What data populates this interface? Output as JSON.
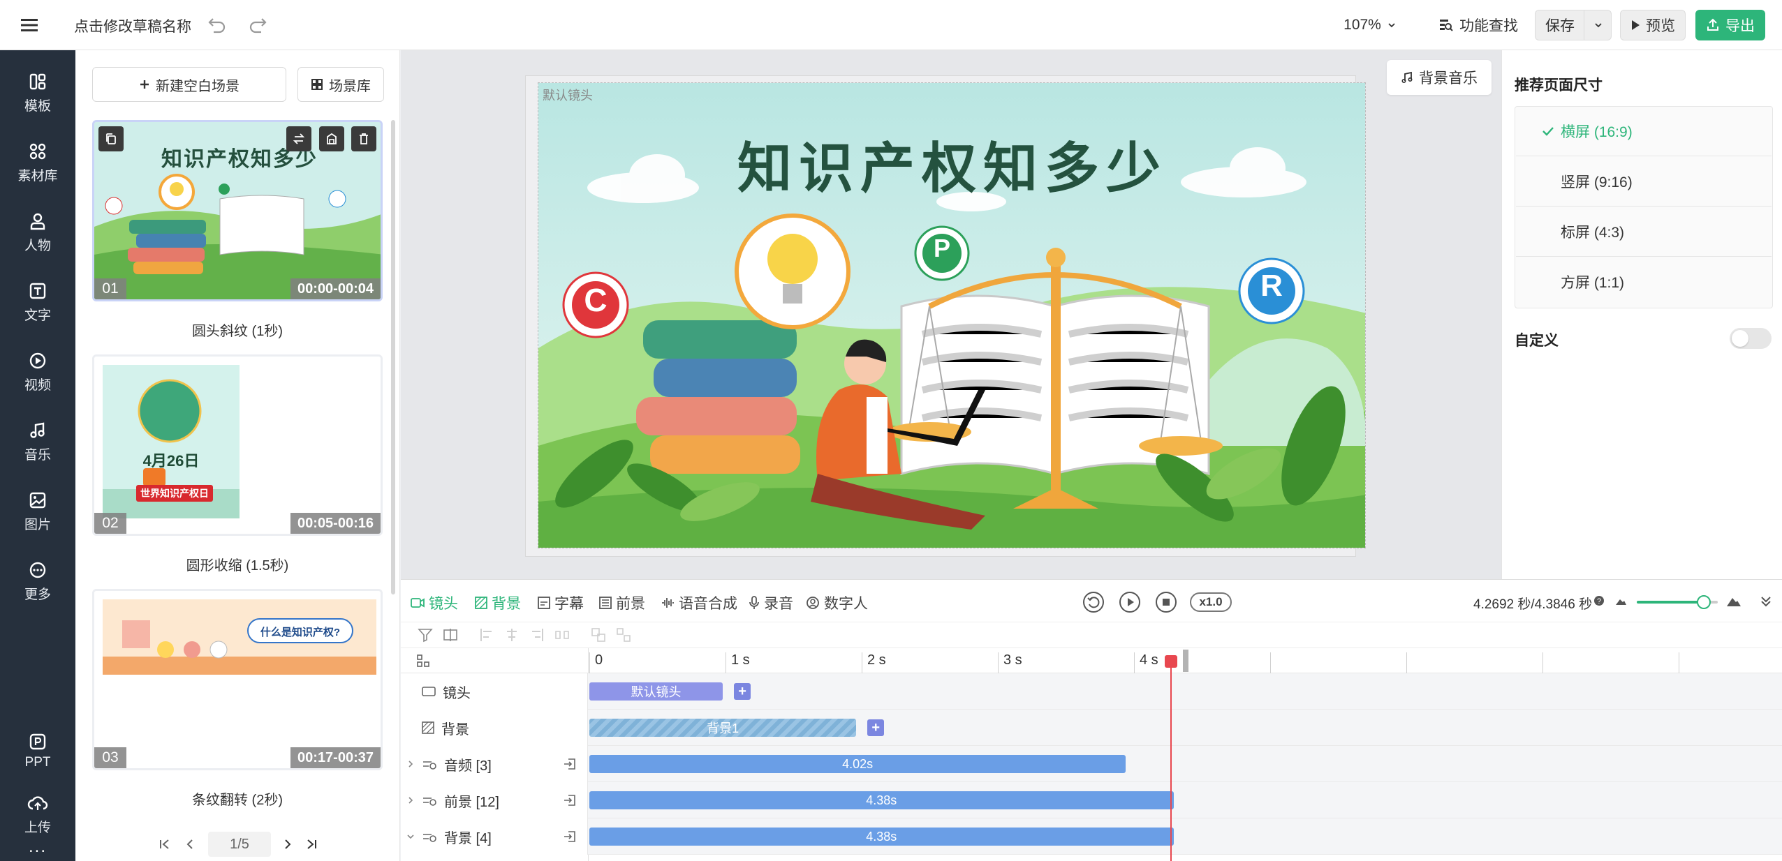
{
  "topbar": {
    "draft_title": "点击修改草稿名称",
    "zoom": "107%",
    "feature_search": "功能查找",
    "save": "保存",
    "preview": "预览",
    "export": "导出"
  },
  "rail": {
    "items": [
      {
        "label": "模板",
        "icon": "template-icon"
      },
      {
        "label": "素材库",
        "icon": "material-icon"
      },
      {
        "label": "人物",
        "icon": "person-icon"
      },
      {
        "label": "文字",
        "icon": "text-icon"
      },
      {
        "label": "视频",
        "icon": "video-icon"
      },
      {
        "label": "音乐",
        "icon": "music-icon"
      },
      {
        "label": "图片",
        "icon": "image-icon"
      },
      {
        "label": "更多",
        "icon": "more-icon"
      }
    ],
    "ppt": "PPT",
    "upload": "上传",
    "overflow": "..."
  },
  "scenes": {
    "new_scene": "新建空白场景",
    "library": "场景库",
    "items": [
      {
        "index": "01",
        "time": "00:00-00:04",
        "label": "圆头斜纹 (1秒)",
        "thumb_title": "知识产权知多少"
      },
      {
        "index": "02",
        "time": "00:05-00:16",
        "label": "圆形收缩 (1.5秒)",
        "thumb_title": "4月26日",
        "thumb_sub": "世界知识产权日"
      },
      {
        "index": "03",
        "time": "00:17-00:37",
        "label": "条纹翻转 (2秒)",
        "thumb_title": "什么是知识产权?"
      }
    ],
    "pager": "1/5"
  },
  "stage": {
    "camera_label": "默认镜头",
    "bg_music": "背景音乐",
    "title": "知识产权知多少",
    "marks": [
      "C",
      "P",
      "R"
    ]
  },
  "rpanel": {
    "title": "推荐页面尺寸",
    "ratios": [
      {
        "label": "横屏 (16:9)",
        "selected": true
      },
      {
        "label": "竖屏 (9:16)",
        "selected": false
      },
      {
        "label": "标屏 (4:3)",
        "selected": false
      },
      {
        "label": "方屏 (1:1)",
        "selected": false
      }
    ],
    "custom": "自定义"
  },
  "timeline": {
    "tabs": [
      "镜头",
      "背景",
      "字幕",
      "前景",
      "语音合成",
      "录音",
      "数字人"
    ],
    "speed": "x1.0",
    "time_readout": "4.2692 秒/4.3846 秒",
    "ticks": [
      "0",
      "1 s",
      "2 s",
      "3 s",
      "4 s"
    ],
    "playhead_seconds": 4.27,
    "tracks": [
      {
        "label": "镜头",
        "clip": "默认镜头"
      },
      {
        "label": "背景",
        "clip": "背景1"
      },
      {
        "label": "音频 [3]",
        "clip": "4.02s"
      },
      {
        "label": "前景 [12]",
        "clip": "4.38s"
      },
      {
        "label": "背景 [4]",
        "clip": "4.38s"
      }
    ]
  },
  "colors": {
    "rail_bg": "#26303d",
    "accent_green": "#2db57a",
    "clip_blue": "#6a9ee6",
    "clip_purple": "#8e95e8",
    "playhead_red": "#e8474f"
  }
}
